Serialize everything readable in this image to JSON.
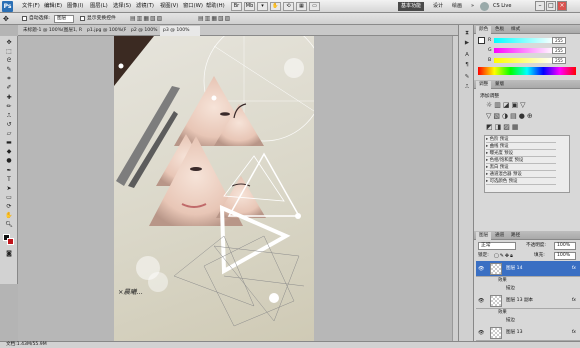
{
  "app": {
    "logo": "Ps"
  },
  "menu": {
    "items": [
      "文件(F)",
      "编辑(E)",
      "图像(I)",
      "图层(L)",
      "选择(S)",
      "滤镜(T)",
      "视图(V)",
      "窗口(W)",
      "帮助(H)"
    ]
  },
  "workspace": {
    "buttons": [
      "基本功能",
      "设计",
      "绘画"
    ],
    "more": "»",
    "cslive": "CS Live"
  },
  "options": {
    "auto_select": "自动选择:",
    "auto_select_value": "图层",
    "show_transform": "显示变换控件"
  },
  "doc_tabs": [
    {
      "label": "未标题-1 @ 100%(图层1, RGB/8)",
      "active": false
    },
    {
      "label": "p1.jpg @ 100%(RGB/8)",
      "active": false
    },
    {
      "label": "p2 @ 100%",
      "active": false
    },
    {
      "label": "p3 @ 100%",
      "active": true
    }
  ],
  "canvas": {
    "signature": "×晨曦...",
    "accent": "#3b2a22"
  },
  "status": {
    "text": "文档:1.43M/55.9M"
  },
  "color_panel": {
    "tabs": [
      "颜色",
      "色板",
      "样式"
    ],
    "channels": [
      {
        "label": "R",
        "value": "255"
      },
      {
        "label": "G",
        "value": "255"
      },
      {
        "label": "B",
        "value": "255"
      }
    ]
  },
  "adjust_panel": {
    "tabs": [
      "调整",
      "蒙版"
    ],
    "heading": "添加调整",
    "presets": [
      "色阶 预设",
      "曲线 预设",
      "曝光度 预设",
      "色相/饱和度 预设",
      "黑白 预设",
      "通道混合器 预设",
      "可选颜色 预设"
    ]
  },
  "layers_panel": {
    "tabs": [
      "图层",
      "通道",
      "路径"
    ],
    "blend_mode": "正常",
    "opacity_label": "不透明度:",
    "opacity": "100%",
    "lock_label": "锁定:",
    "fill_label": "填充:",
    "fill": "100%",
    "layers": [
      {
        "name": "图层 14",
        "fx": "fx",
        "selected": true
      },
      {
        "name": "图层 13 副本",
        "fx": "fx",
        "selected": false
      },
      {
        "name": "图层 13",
        "fx": "fx",
        "selected": false
      }
    ],
    "effects_label": "效果",
    "stroke_label": "描边"
  }
}
